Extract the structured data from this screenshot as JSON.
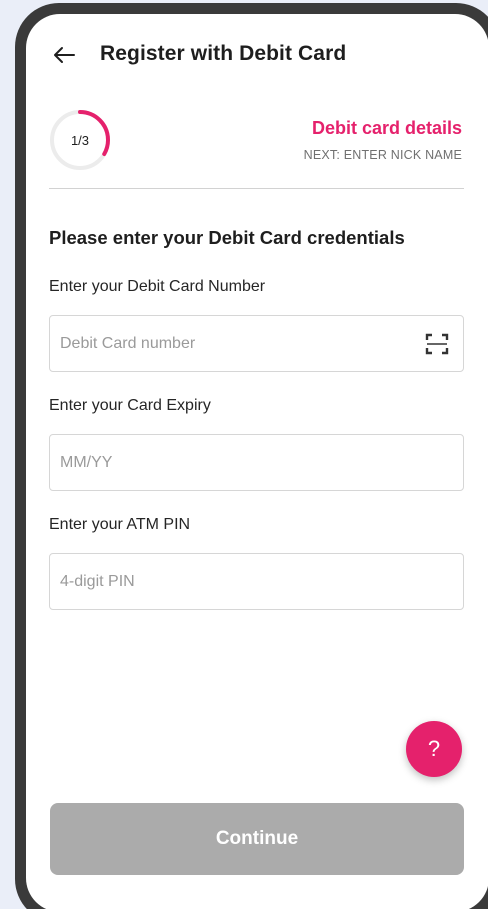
{
  "header": {
    "back_icon": "arrow-left-icon",
    "title": "Register with Debit Card"
  },
  "progress": {
    "label": "1/3",
    "fraction": 0.333,
    "step_title": "Debit card details",
    "next_step": "NEXT: ENTER NICK NAME"
  },
  "form": {
    "heading": "Please enter your Debit Card credentials",
    "card_number": {
      "label": "Enter your Debit Card Number",
      "placeholder": "Debit Card number",
      "value": "",
      "action_icon": "scan-icon"
    },
    "expiry": {
      "label": "Enter your Card Expiry",
      "placeholder": "MM/YY",
      "value": ""
    },
    "pin": {
      "label": "Enter your ATM PIN",
      "placeholder": "4-digit PIN",
      "value": ""
    }
  },
  "help": {
    "icon": "question-mark-icon",
    "label": "?"
  },
  "footer": {
    "continue_label": "Continue"
  },
  "colors": {
    "accent": "#e5216c",
    "disabled_button": "#ababab",
    "page_background": "#eaeef8"
  }
}
